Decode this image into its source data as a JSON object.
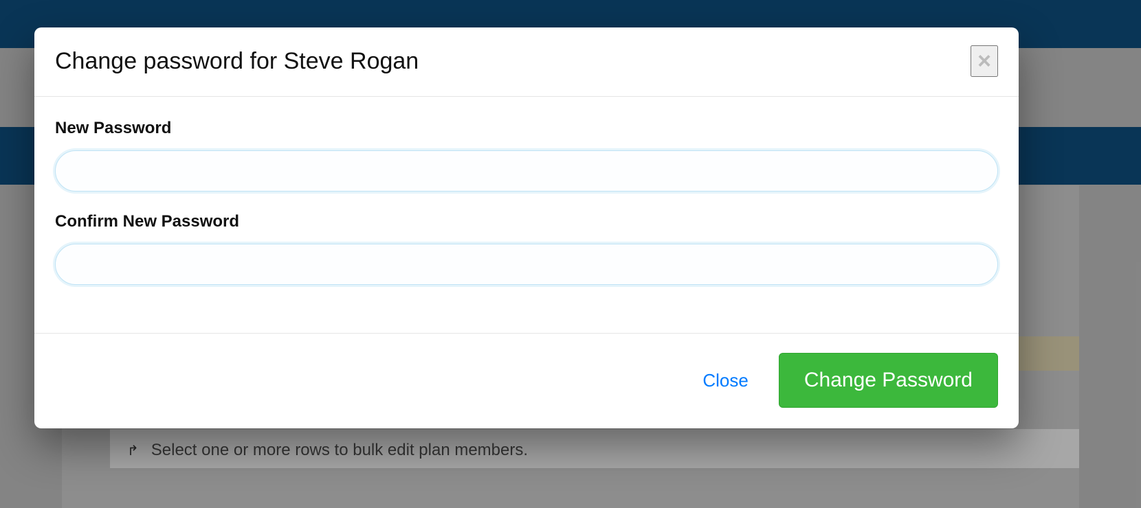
{
  "modal": {
    "title": "Change password for Steve Rogan",
    "fields": {
      "new_password": {
        "label": "New Password",
        "value": ""
      },
      "confirm_password": {
        "label": "Confirm New Password",
        "value": ""
      }
    },
    "buttons": {
      "close": "Close",
      "submit": "Change Password"
    }
  },
  "page": {
    "hint": "Select one or more rows to bulk edit plan members."
  }
}
